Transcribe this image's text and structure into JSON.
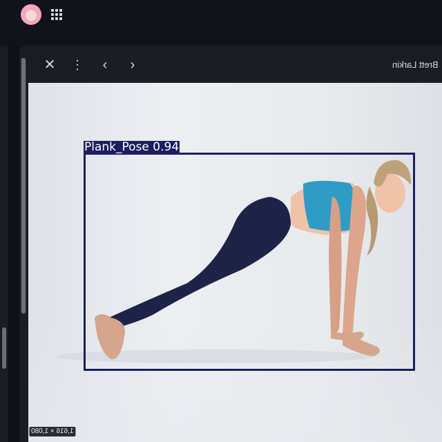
{
  "topbar": {
    "avatar_icon": "avatar",
    "apps_icon": "apps-grid-icon"
  },
  "viewer": {
    "toolbar": {
      "close_icon": "close-icon",
      "menu_icon": "more-vert-icon",
      "prev_icon": "chevron-left-icon",
      "next_icon": "chevron-right-icon",
      "author": "Brett Larkin"
    },
    "image": {
      "dimensions": "1,616 × 1,080",
      "detection": {
        "label": "Plank_Pose 0.94",
        "color": "#1b1f5f"
      },
      "sports_bra_color": "#2f9cc7",
      "leggings_color": "#1e2447"
    }
  }
}
